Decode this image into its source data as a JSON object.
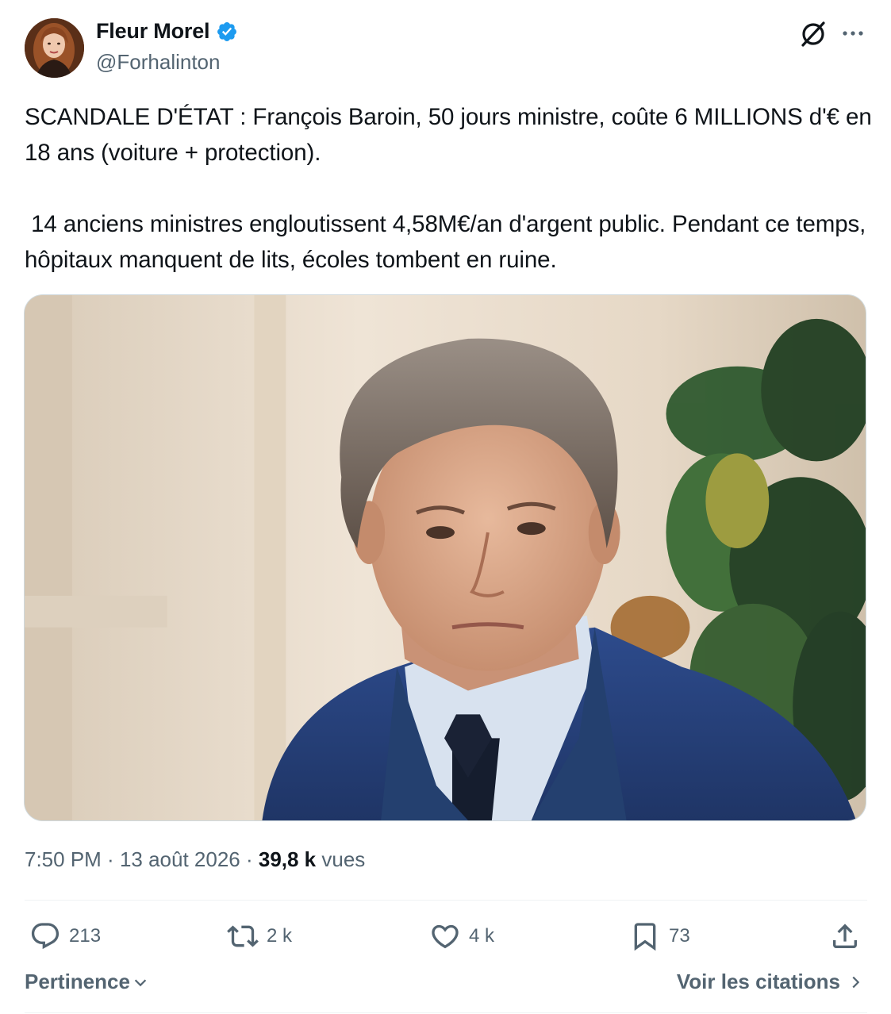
{
  "author": {
    "display_name": "Fleur Morel",
    "handle": "@Forhalinton",
    "verified": true,
    "verified_color": "#1d9bf0"
  },
  "tweet": {
    "paragraphs": [
      "SCANDALE D'ÉTAT : François Baroin, 50 jours ministre, coûte 6 MILLIONS d'€ en 18 ans (voiture + protection).",
      " 14 anciens ministres engloutissent 4,58M€/an d'argent public. Pendant ce temps, hôpitaux manquent de lits, écoles tombent en ruine."
    ]
  },
  "meta": {
    "time": "7:50 PM",
    "separator": " · ",
    "date": "13 août 2026",
    "views_count": "39,8 k",
    "views_label": " vues"
  },
  "actions": {
    "replies": "213",
    "reposts": "2 k",
    "likes": "4 k",
    "bookmarks": "73"
  },
  "footer": {
    "sort_label": "Pertinence",
    "quotes_label": "Voir les citations"
  },
  "icons": [
    "grok-icon",
    "more-icon",
    "verified-badge-icon",
    "reply-icon",
    "repost-icon",
    "like-icon",
    "bookmark-icon",
    "share-icon",
    "chevron-down-icon",
    "chevron-right-icon"
  ],
  "colors": {
    "text": "#0f1419",
    "secondary": "#536471",
    "border": "#eff3f4"
  }
}
